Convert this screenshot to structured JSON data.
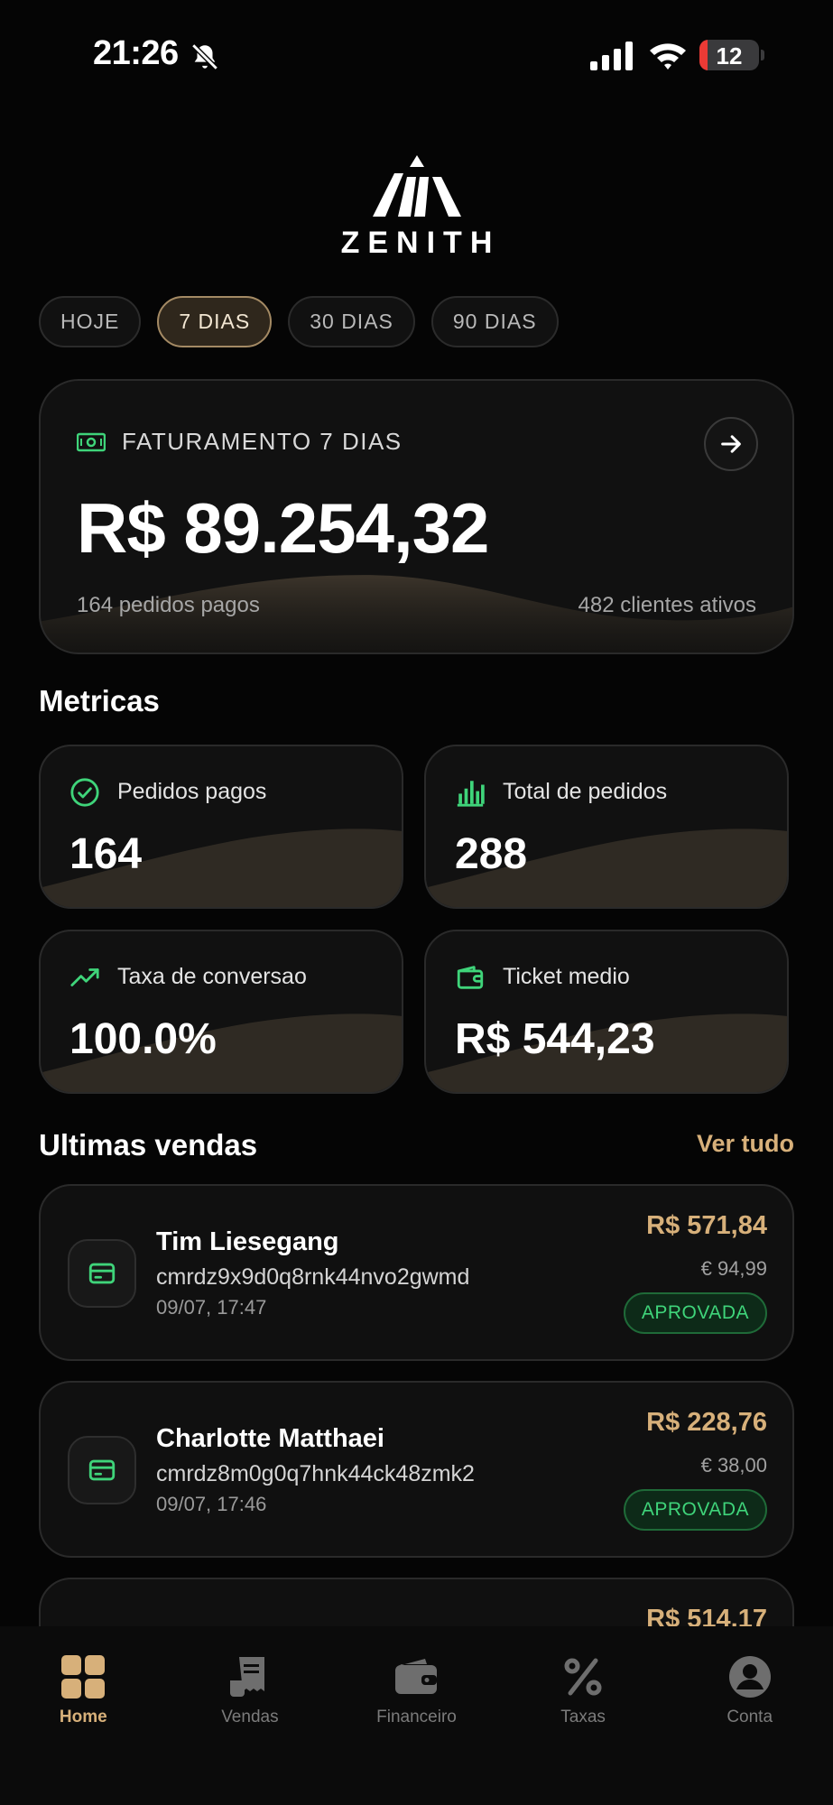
{
  "status_bar": {
    "time": "21:26",
    "battery": "12"
  },
  "brand": {
    "name": "ZENITH"
  },
  "periods": [
    {
      "label": "HOJE",
      "active": false
    },
    {
      "label": "7 DIAS",
      "active": true
    },
    {
      "label": "30 DIAS",
      "active": false
    },
    {
      "label": "90 DIAS",
      "active": false
    }
  ],
  "revenue": {
    "label": "FATURAMENTO 7 DIAS",
    "value": "R$ 89.254,32",
    "orders_paid": "164 pedidos pagos",
    "active_clients": "482 clientes ativos"
  },
  "metrics": {
    "title": "Metricas",
    "items": [
      {
        "label": "Pedidos pagos",
        "value": "164",
        "icon": "check-circle-icon"
      },
      {
        "label": "Total de pedidos",
        "value": "288",
        "icon": "bar-chart-icon"
      },
      {
        "label": "Taxa de conversao",
        "value": "100.0%",
        "icon": "trending-up-icon"
      },
      {
        "label": "Ticket medio",
        "value": "R$ 544,23",
        "icon": "wallet-icon"
      }
    ]
  },
  "sales": {
    "title": "Ultimas vendas",
    "see_all": "Ver tudo",
    "items": [
      {
        "name": "Tim Liesegang",
        "id": "cmrdz9x9d0q8rnk44nvo2gwmd",
        "date": "09/07, 17:47",
        "amount": "R$ 571,84",
        "amount_eur": "€ 94,99",
        "status": "APROVADA"
      },
      {
        "name": "Charlotte Matthaei",
        "id": "cmrdz8m0g0q7hnk44ck48zmk2",
        "date": "09/07, 17:46",
        "amount": "R$ 228,76",
        "amount_eur": "€ 38,00",
        "status": "APROVADA"
      },
      {
        "amount": "R$ 514,17"
      }
    ]
  },
  "nav": [
    {
      "label": "Home",
      "icon": "grid-icon",
      "active": true
    },
    {
      "label": "Vendas",
      "icon": "receipt-icon",
      "active": false
    },
    {
      "label": "Financeiro",
      "icon": "wallet-icon",
      "active": false
    },
    {
      "label": "Taxas",
      "icon": "percent-icon",
      "active": false
    },
    {
      "label": "Conta",
      "icon": "account-icon",
      "active": false
    }
  ],
  "colors": {
    "accent": "#d7b07a",
    "positive": "#3fd47a",
    "background": "#050505",
    "card": "#111111"
  }
}
